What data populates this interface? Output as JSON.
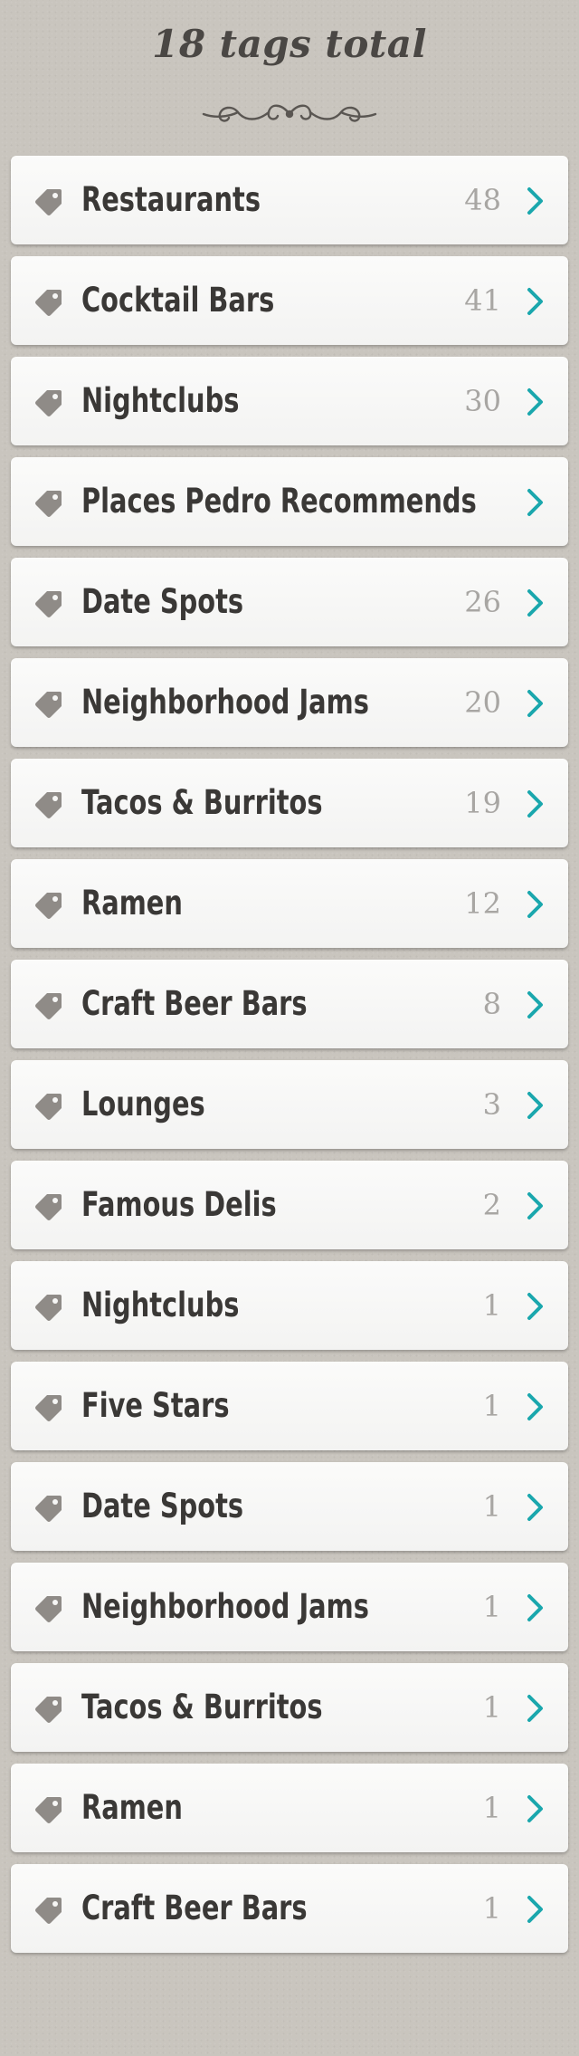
{
  "header": {
    "title": "18 tags total"
  },
  "colors": {
    "accent": "#1aa7ad",
    "icon": "#8f8b87",
    "label": "#3a3836",
    "count": "#a8a6a3"
  },
  "tags": [
    {
      "label": "Restaurants",
      "count": "48",
      "icon": "tag-icon"
    },
    {
      "label": "Cocktail Bars",
      "count": "41",
      "icon": "tag-icon"
    },
    {
      "label": "Nightclubs",
      "count": "30",
      "icon": "tag-icon"
    },
    {
      "label": "Places Pedro Recommends",
      "count": "",
      "icon": "tag-icon"
    },
    {
      "label": "Date Spots",
      "count": "26",
      "icon": "tag-icon"
    },
    {
      "label": "Neighborhood Jams",
      "count": "20",
      "icon": "tag-icon"
    },
    {
      "label": "Tacos & Burritos",
      "count": "19",
      "icon": "tag-icon"
    },
    {
      "label": "Ramen",
      "count": "12",
      "icon": "tag-icon"
    },
    {
      "label": "Craft Beer Bars",
      "count": "8",
      "icon": "tag-icon"
    },
    {
      "label": "Lounges",
      "count": "3",
      "icon": "tag-icon"
    },
    {
      "label": "Famous Delis",
      "count": "2",
      "icon": "tag-icon"
    },
    {
      "label": "Nightclubs",
      "count": "1",
      "icon": "tag-icon"
    },
    {
      "label": "Five Stars",
      "count": "1",
      "icon": "tag-icon"
    },
    {
      "label": "Date Spots",
      "count": "1",
      "icon": "tag-icon"
    },
    {
      "label": "Neighborhood Jams",
      "count": "1",
      "icon": "tag-icon"
    },
    {
      "label": "Tacos & Burritos",
      "count": "1",
      "icon": "tag-icon"
    },
    {
      "label": "Ramen",
      "count": "1",
      "icon": "tag-icon"
    },
    {
      "label": "Craft Beer Bars",
      "count": "1",
      "icon": "tag-icon"
    }
  ]
}
